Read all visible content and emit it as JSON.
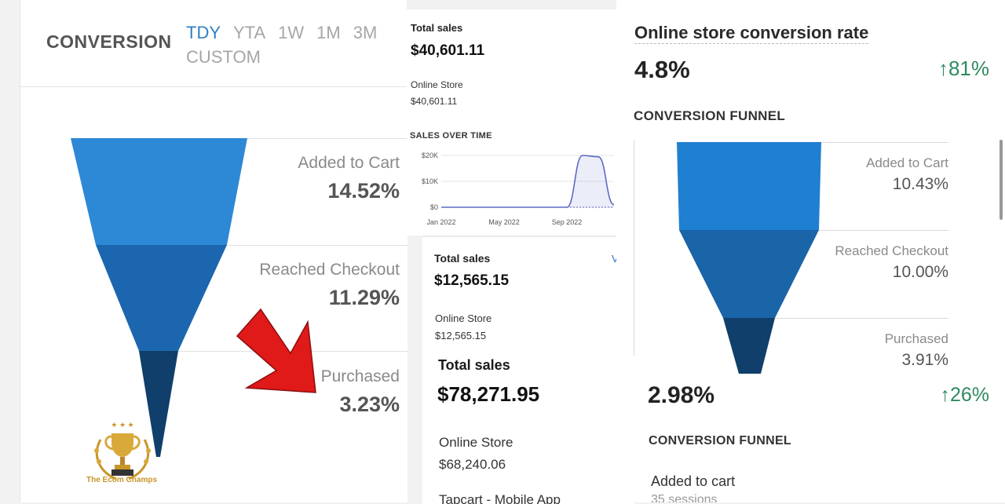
{
  "panel1": {
    "title": "CONVERSION",
    "tabs": [
      {
        "label": "TDY",
        "active": true
      },
      {
        "label": "YTA",
        "active": false
      },
      {
        "label": "1W",
        "active": false
      },
      {
        "label": "1M",
        "active": false
      },
      {
        "label": "3M",
        "active": false
      },
      {
        "label": "CUSTOM",
        "active": false
      }
    ],
    "funnel": [
      {
        "label": "Added to Cart",
        "value": "14.52%"
      },
      {
        "label": "Reached Checkout",
        "value": "11.29%"
      },
      {
        "label": "Purchased",
        "value": "3.23%"
      }
    ],
    "brand": "The Ecom Champs"
  },
  "panel2": {
    "total_sales_label": "Total sales",
    "total_sales_value": "$40,601.11",
    "channel_label": "Online Store",
    "channel_value": "$40,601.11",
    "chart_title": "SALES OVER TIME"
  },
  "chart_data": {
    "type": "line",
    "title": "SALES OVER TIME",
    "y_ticks": [
      "$20K",
      "$10K",
      "$0"
    ],
    "ylim": [
      0,
      20000
    ],
    "x_ticks": [
      "Jan 2022",
      "May 2022",
      "Sep 2022"
    ],
    "series": [
      {
        "x": [
          "Jan 2022",
          "Feb 2022",
          "Mar 2022",
          "Apr 2022",
          "May 2022",
          "Jun 2022",
          "Jul 2022",
          "Aug 2022",
          "Sep 2022",
          "Oct 2022",
          "Nov 2022",
          "Dec 2022"
        ],
        "values": [
          0,
          0,
          0,
          0,
          0,
          0,
          0,
          0,
          0,
          20000,
          19500,
          1000
        ]
      }
    ],
    "grid": true
  },
  "panel3": {
    "sales1_label": "Total sales",
    "sales1_value": "$12,565.15",
    "view_link": "View",
    "channel1_label": "Online Store",
    "channel1_value": "$12,565.15",
    "sales2_label": "Total sales",
    "sales2_value": "$78,271.95",
    "channel2_label": "Online Store",
    "channel2_value": "$68,240.06",
    "channel3_label": "Tapcart - Mobile App"
  },
  "panel4": {
    "title": "Online store conversion rate",
    "rate": "4.8%",
    "delta": "↑81%",
    "funnel_title": "CONVERSION FUNNEL",
    "funnel": [
      {
        "label": "Added to Cart",
        "value": "10.43%"
      },
      {
        "label": "Reached Checkout",
        "value": "10.00%"
      },
      {
        "label": "Purchased",
        "value": "3.91%"
      }
    ],
    "rate2": "2.98%",
    "delta2": "↑26%",
    "funnel_title2": "CONVERSION FUNNEL",
    "added_label": "Added to cart",
    "added_sessions": "35 sessions"
  },
  "colors": {
    "funnel_top": "#2d88d6",
    "funnel_mid": "#1b66ae",
    "funnel_bottom": "#0f3f6a",
    "accent_blue": "#2f7fc1",
    "positive_green": "#2e8a5f",
    "arrow_red": "#e01919"
  }
}
